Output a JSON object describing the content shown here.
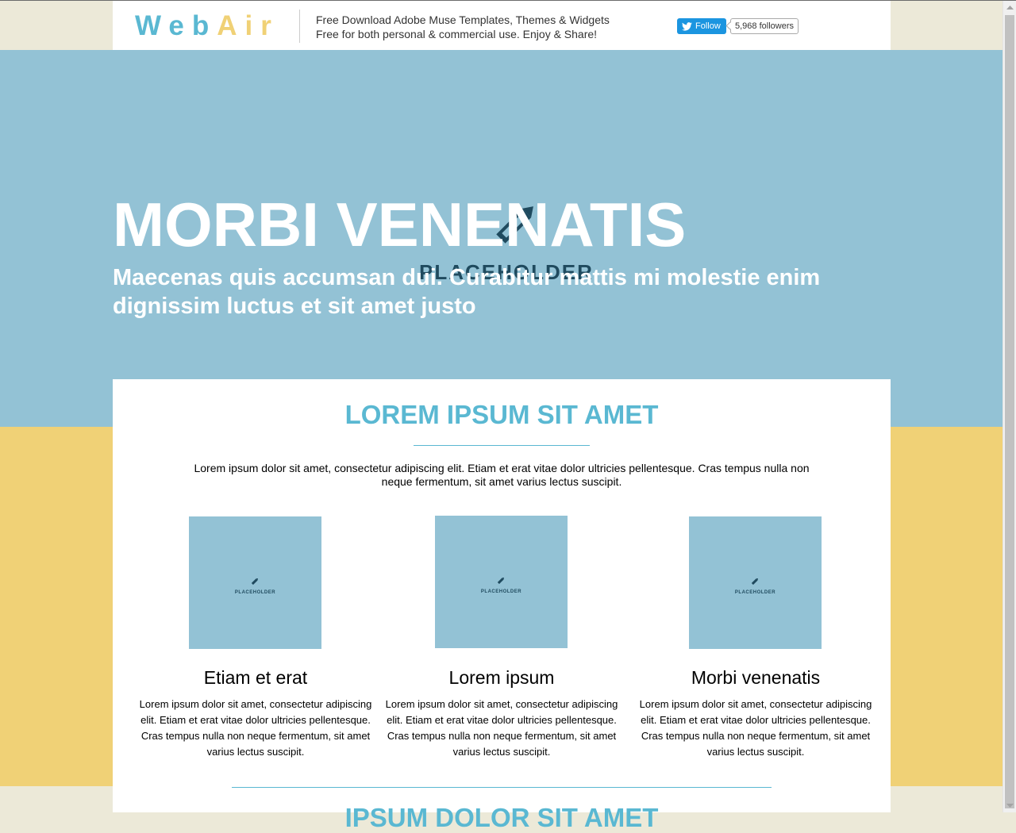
{
  "header": {
    "logo_part1": "Web",
    "logo_part2": "Air",
    "tagline_line1": "Free Download Adobe Muse Templates, Themes & Widgets",
    "tagline_line2": "Free for both personal & commercial use. Enjoy & Share!",
    "twitter_follow_label": "Follow",
    "twitter_followers": "5,968 followers"
  },
  "hero": {
    "title": "MORBI VENENATIS",
    "subtitle": "Maecenas quis accumsan dui. Curabitur mattis mi molestie enim dignissim luctus et sit amet justo",
    "placeholder_word": "PLACEHOLDER"
  },
  "section1": {
    "title": "LOREM IPSUM SIT AMET",
    "text": "Lorem ipsum dolor sit amet, consectetur adipiscing elit. Etiam et erat vitae dolor ultricies pellentesque. Cras tempus nulla non neque fermentum, sit amet varius lectus suscipit."
  },
  "cards": [
    {
      "placeholder": "PLACEHOLDER",
      "title": "Etiam et erat",
      "text": "Lorem ipsum dolor sit amet, consectetur adipiscing elit. Etiam et erat vitae dolor ultricies pellentesque. Cras tempus nulla non neque fermentum, sit amet varius lectus suscipit."
    },
    {
      "placeholder": "PLACEHOLDER",
      "title": "Lorem ipsum",
      "text": "Lorem ipsum dolor sit amet, consectetur adipiscing elit. Etiam et erat vitae dolor ultricies pellentesque. Cras tempus nulla non neque fermentum, sit amet varius lectus suscipit."
    },
    {
      "placeholder": "PLACEHOLDER",
      "title": "Morbi venenatis",
      "text": "Lorem ipsum dolor sit amet, consectetur adipiscing elit. Etiam et erat vitae dolor ultricies pellentesque. Cras tempus nulla non neque fermentum, sit amet varius lectus suscipit."
    }
  ],
  "section2": {
    "title": "IPSUM DOLOR SIT AMET"
  },
  "colors": {
    "accent_blue": "#5ab8d2",
    "hero_blue": "#93c2d5",
    "accent_yellow": "#f0d176",
    "page_beige": "#ece9d8",
    "twitter_blue": "#1b95e0"
  },
  "icons": {
    "twitter": "twitter-bird-icon",
    "placeholder": "pencil-icon",
    "scroll_up": "scroll-up-arrow-icon",
    "scroll_down": "scroll-down-arrow-icon"
  }
}
